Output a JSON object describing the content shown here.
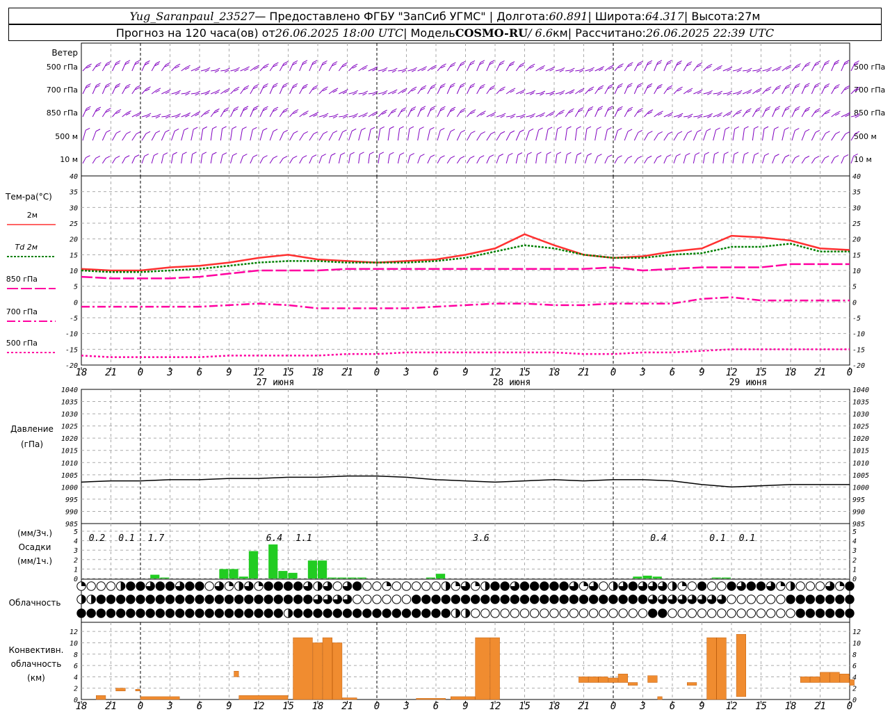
{
  "header": {
    "station": "Yug_Saranpaul_23527",
    "provider": " — Предоставлено ФГБУ \"ЗапСиб УГМС\" | Долгота: ",
    "lon": "60.891",
    "lat_label": " | Широта: ",
    "lat": "64.317",
    "alt_label": " | Высота: ",
    "alt": "27м",
    "forecast_prefix": "Прогноз на 120 часа(ов) от ",
    "forecast_start": "26.06.2025 18:00 UTC",
    "model_label": "  | Модель ",
    "model": "COSMO-RU",
    "resolution": " / 6.6",
    "res_unit": "км",
    "calc_label": " | Рассчитано: ",
    "calc_time": "26.06.2025 22:39 UTC"
  },
  "x_tick_labels": [
    "18",
    "21",
    "0",
    "3",
    "6",
    "9",
    "12",
    "15",
    "18",
    "21",
    "0",
    "3",
    "6",
    "9",
    "12",
    "15",
    "18",
    "21",
    "0",
    "3",
    "6",
    "9",
    "12",
    "15",
    "18",
    "21",
    "0"
  ],
  "day_labels": [
    "27 июня",
    "28 июня",
    "29 июня"
  ],
  "wind_panel": {
    "title": "Ветер",
    "levels": [
      "500 гПа",
      "700 гПа",
      "850 гПа",
      "500 м",
      "10 м"
    ],
    "color": "#8000c0"
  },
  "temp_panel": {
    "title": "Тем-ра(°С)",
    "legend": [
      {
        "label": "2м",
        "color": "#ff3030"
      },
      {
        "label": "Td 2м",
        "color": "#008000"
      },
      {
        "label": "850 гПа",
        "color": "#ff00a0"
      },
      {
        "label": "700 гПа",
        "color": "#ff00a0"
      },
      {
        "label": "500 гПа",
        "color": "#ff00a0"
      }
    ],
    "y_ticks": [
      "40",
      "35",
      "30",
      "25",
      "20",
      "15",
      "10",
      "5",
      "0",
      "-5",
      "-10",
      "-15",
      "-20"
    ]
  },
  "pressure_panel": {
    "title_line1": "Давление",
    "title_line2": "(гПа)",
    "y_ticks": [
      "1040",
      "1035",
      "1030",
      "1025",
      "1020",
      "1015",
      "1010",
      "1005",
      "1000",
      "995",
      "990",
      "985"
    ]
  },
  "precip_panel": {
    "unit3h": "(мм/3ч.)",
    "title": "Осадки",
    "unit1h": "(мм/1ч.)",
    "y_ticks": [
      "5",
      "4",
      "3",
      "2",
      "1",
      "0"
    ],
    "totals": [
      {
        "hour": 3,
        "text": "0.2"
      },
      {
        "hour": 6,
        "text": "0.1"
      },
      {
        "hour": 9,
        "text": "1.7"
      },
      {
        "hour": 21,
        "text": "6.4"
      },
      {
        "hour": 24,
        "text": "1.1"
      },
      {
        "hour": 42,
        "text": "3.6"
      },
      {
        "hour": 60,
        "text": "0.4"
      },
      {
        "hour": 66,
        "text": "0.1"
      },
      {
        "hour": 69,
        "text": "0.1"
      }
    ]
  },
  "cloud_panel": {
    "title": "Облачность"
  },
  "conv_panel": {
    "title_line1": "Конвективн.",
    "title_line2": "облачность",
    "title_line3": "(км)",
    "y_ticks": [
      "12",
      "10",
      "8",
      "6",
      "4",
      "2",
      "0"
    ]
  },
  "chart_data": [
    {
      "type": "line",
      "title": "Тем-ра(°С)",
      "x_hours_from_start": [
        0,
        3,
        6,
        9,
        12,
        15,
        18,
        21,
        24,
        27,
        30,
        33,
        36,
        39,
        42,
        45,
        48,
        51,
        54,
        57,
        60,
        63,
        66,
        69,
        72,
        75,
        78
      ],
      "ylim": [
        -20,
        40
      ],
      "series": [
        {
          "name": "2м",
          "values": [
            10.5,
            10,
            10,
            11,
            11.5,
            12.5,
            14,
            15,
            13.5,
            13,
            12.5,
            13,
            13.5,
            15,
            17,
            21.5,
            18,
            15,
            14,
            14.5,
            16,
            17,
            21,
            20.5,
            19.5,
            17,
            16.5
          ]
        },
        {
          "name": "Td 2м",
          "values": [
            10,
            9.5,
            9.5,
            10,
            10.5,
            11.5,
            12.5,
            13,
            13,
            12.5,
            12.5,
            12.5,
            13,
            14,
            16,
            18,
            17,
            15,
            14,
            14,
            15,
            15.5,
            17.5,
            17.5,
            18.5,
            16,
            16
          ]
        },
        {
          "name": "850 гПа",
          "values": [
            8,
            7.5,
            7.5,
            7.5,
            8,
            9,
            10,
            10,
            10,
            10.5,
            10.5,
            10.5,
            10.5,
            10.5,
            10.5,
            10.5,
            10.5,
            10.5,
            11,
            10,
            10.5,
            11,
            11,
            11,
            12,
            12,
            12
          ]
        },
        {
          "name": "700 гПа",
          "values": [
            -1.5,
            -1.5,
            -1.5,
            -1.5,
            -1.5,
            -1,
            -0.5,
            -1,
            -2,
            -2,
            -2,
            -2,
            -1.5,
            -1,
            -0.5,
            -0.5,
            -1,
            -1,
            -0.5,
            -0.5,
            -0.5,
            1,
            1.5,
            0.5,
            0.5,
            0.5,
            0.5
          ]
        },
        {
          "name": "500 гПа",
          "values": [
            -17,
            -17.5,
            -17.5,
            -17.5,
            -17.5,
            -17,
            -17,
            -17,
            -17,
            -16.5,
            -16.5,
            -16,
            -16,
            -16,
            -16,
            -16,
            -16,
            -16.5,
            -16.5,
            -16,
            -16,
            -15.5,
            -15,
            -15,
            -15,
            -15,
            -15
          ]
        }
      ]
    },
    {
      "type": "line",
      "title": "Давление",
      "x_hours_from_start": [
        0,
        3,
        6,
        9,
        12,
        15,
        18,
        21,
        24,
        27,
        30,
        33,
        36,
        39,
        42,
        45,
        48,
        51,
        54,
        57,
        60,
        63,
        66,
        69,
        72,
        75,
        78
      ],
      "ylim": [
        985,
        1040
      ],
      "series": [
        {
          "name": "Давление",
          "values": [
            1002,
            1002.5,
            1002.5,
            1003,
            1003,
            1003.5,
            1003.5,
            1004,
            1004,
            1004.5,
            1004.5,
            1004,
            1003,
            1002.5,
            1002,
            1002.5,
            1003,
            1002.5,
            1003,
            1003,
            1002.5,
            1001,
            1000,
            1000.5,
            1001,
            1001,
            1001
          ]
        }
      ]
    },
    {
      "type": "bar",
      "title": "Осадки",
      "unit": "мм/1ч.",
      "ylim": [
        0,
        5
      ],
      "x_hours_from_start": [
        8,
        9,
        15,
        16,
        17,
        18,
        20,
        21,
        22,
        24,
        25,
        26,
        27,
        28,
        29,
        36,
        37,
        57,
        58,
        59,
        65,
        66
      ],
      "values": [
        0.4,
        0.1,
        1.0,
        1.0,
        0.2,
        2.9,
        3.6,
        0.8,
        0.6,
        1.9,
        1.9,
        0.1,
        0.1,
        0.1,
        0.1,
        0.1,
        0.5,
        0.2,
        0.3,
        0.2,
        0.1,
        0.1
      ]
    },
    {
      "type": "bar",
      "title": "Конвективн. облачность",
      "unit": "км",
      "ylim": [
        0,
        13
      ],
      "bars": [
        {
          "from": 1.5,
          "to": 2.5,
          "base": 0,
          "top": 0.7
        },
        {
          "from": 3.5,
          "to": 4.5,
          "base": 1.5,
          "top": 2
        },
        {
          "from": 5.5,
          "to": 6,
          "base": 1.5,
          "top": 1.8
        },
        {
          "from": 6,
          "to": 10,
          "base": 0,
          "top": 0.5
        },
        {
          "from": 15.5,
          "to": 16,
          "base": 4,
          "top": 5
        },
        {
          "from": 16,
          "to": 21,
          "base": 0,
          "top": 0.7
        },
        {
          "from": 21.5,
          "to": 23.5,
          "base": 0,
          "top": 10.9
        },
        {
          "from": 23.5,
          "to": 24.5,
          "base": 0,
          "top": 10
        },
        {
          "from": 24.5,
          "to": 25.5,
          "base": 0,
          "top": 10.9
        },
        {
          "from": 25.5,
          "to": 26.5,
          "base": 0,
          "top": 10
        },
        {
          "from": 26.5,
          "to": 28,
          "base": 0,
          "top": 0.3
        },
        {
          "from": 34,
          "to": 37,
          "base": 0,
          "top": 0.2
        },
        {
          "from": 37.5,
          "to": 40,
          "base": 0,
          "top": 0.5
        },
        {
          "from": 40,
          "to": 41.5,
          "base": 0,
          "top": 10.9
        },
        {
          "from": 41.5,
          "to": 42.5,
          "base": 0,
          "top": 10.9
        },
        {
          "from": 50.5,
          "to": 51.5,
          "base": 3,
          "top": 4
        },
        {
          "from": 51.5,
          "to": 52.5,
          "base": 3,
          "top": 4
        },
        {
          "from": 52.5,
          "to": 53.5,
          "base": 3,
          "top": 4
        },
        {
          "from": 53.5,
          "to": 54.5,
          "base": 3,
          "top": 3.8
        },
        {
          "from": 54.5,
          "to": 55.5,
          "base": 3,
          "top": 4.5
        },
        {
          "from": 55.5,
          "to": 56.5,
          "base": 2.5,
          "top": 3
        },
        {
          "from": 57.5,
          "to": 58.5,
          "base": 3,
          "top": 4.2
        },
        {
          "from": 58.5,
          "to": 59,
          "base": 0,
          "top": 0.5
        },
        {
          "from": 61.5,
          "to": 62.5,
          "base": 2.5,
          "top": 3
        },
        {
          "from": 63.5,
          "to": 64.5,
          "base": 0,
          "top": 10.9
        },
        {
          "from": 64.5,
          "to": 65.5,
          "base": 0,
          "top": 10.9
        },
        {
          "from": 66.5,
          "to": 67.5,
          "base": 0.5,
          "top": 11.5
        },
        {
          "from": 73,
          "to": 74,
          "base": 3,
          "top": 4
        },
        {
          "from": 74,
          "to": 75,
          "base": 3,
          "top": 4
        },
        {
          "from": 75,
          "to": 76,
          "base": 3,
          "top": 4.8
        },
        {
          "from": 76,
          "to": 77,
          "base": 3,
          "top": 4.8
        },
        {
          "from": 77,
          "to": 78,
          "base": 3,
          "top": 4.5
        },
        {
          "from": 78,
          "to": 78.5,
          "base": 2.5,
          "top": 3.5
        }
      ]
    }
  ]
}
